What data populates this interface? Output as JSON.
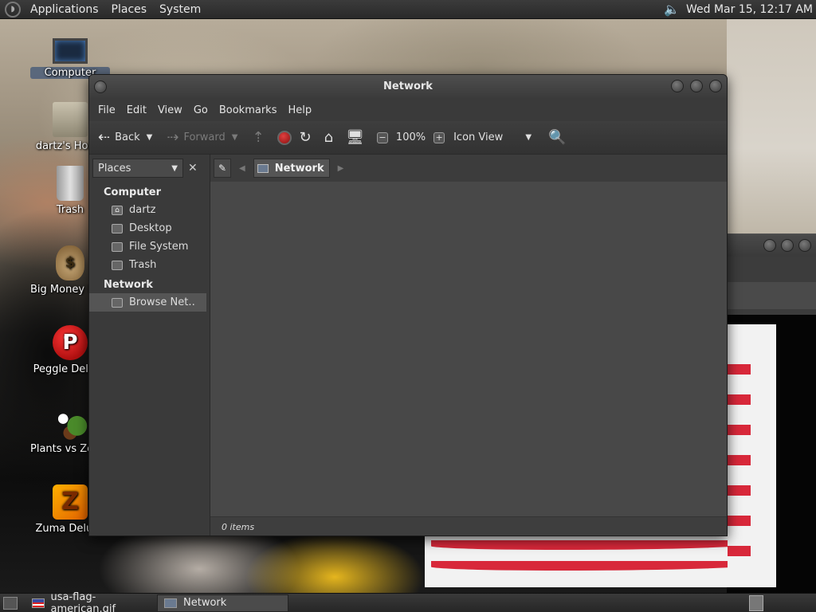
{
  "top_panel": {
    "menus": [
      "Applications",
      "Places",
      "System"
    ],
    "clock": "Wed Mar 15, 12:17 AM"
  },
  "desktop_icons": [
    {
      "label": "Computer",
      "icon": "computer-icon"
    },
    {
      "label": "dartz's Home",
      "icon": "home-folder-icon"
    },
    {
      "label": "Trash",
      "icon": "trash-icon"
    },
    {
      "label": "Big Money Deluxe",
      "icon": "big-money-icon"
    },
    {
      "label": "Peggle Deluxe",
      "icon": "peggle-icon"
    },
    {
      "label": "Plants vs Zombies",
      "icon": "plants-vs-zombies-icon"
    },
    {
      "label": "Zuma Deluxe",
      "icon": "zuma-icon"
    }
  ],
  "window": {
    "title": "Network",
    "menu": [
      "File",
      "Edit",
      "View",
      "Go",
      "Bookmarks",
      "Help"
    ],
    "toolbar": {
      "back": "Back",
      "forward": "Forward",
      "zoom": "100%",
      "view_mode": "Icon View"
    },
    "sidebar": {
      "selector": "Places",
      "sections": [
        {
          "title": "Computer",
          "items": [
            {
              "label": "dartz",
              "icon": "home-icon"
            },
            {
              "label": "Desktop",
              "icon": "desktop-icon"
            },
            {
              "label": "File System",
              "icon": "drive-icon"
            },
            {
              "label": "Trash",
              "icon": "trash-icon"
            }
          ]
        },
        {
          "title": "Network",
          "items": [
            {
              "label": "Browse Net…",
              "icon": "network-icon",
              "active": true
            }
          ]
        }
      ]
    },
    "path": {
      "crumb": "Network"
    },
    "status": "0 items"
  },
  "taskbar": {
    "tasks": [
      {
        "label": "usa-flag-american.gif",
        "icon": "flag-icon",
        "active": false
      },
      {
        "label": "Network",
        "icon": "network-icon",
        "active": true
      }
    ]
  }
}
